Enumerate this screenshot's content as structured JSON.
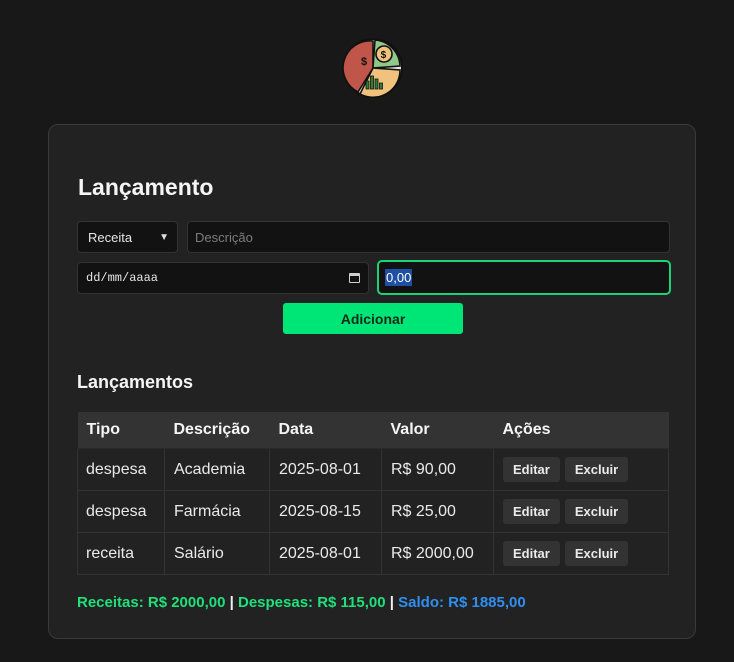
{
  "form": {
    "title": "Lançamento",
    "type_select": {
      "selected": "Receita",
      "chevron_icon": "chevron-down-icon"
    },
    "description_input": {
      "placeholder": "Descrição"
    },
    "date_input": {
      "placeholder": "dd/mm/aaaa",
      "icon": "calendar-icon"
    },
    "value_input": {
      "value": "0,00"
    },
    "add_button": "Adicionar"
  },
  "list": {
    "title": "Lançamentos",
    "columns": [
      "Tipo",
      "Descrição",
      "Data",
      "Valor",
      "Ações"
    ],
    "rows": [
      {
        "tipo": "despesa",
        "descricao": "Academia",
        "data": "2025-08-01",
        "valor": "R$ 90,00",
        "edit": "Editar",
        "delete": "Excluir"
      },
      {
        "tipo": "despesa",
        "descricao": "Farmácia",
        "data": "2025-08-15",
        "valor": "R$ 25,00",
        "edit": "Editar",
        "delete": "Excluir"
      },
      {
        "tipo": "receita",
        "descricao": "Salário",
        "data": "2025-08-01",
        "valor": "R$ 2000,00",
        "edit": "Editar",
        "delete": "Excluir"
      }
    ]
  },
  "totals": {
    "receitas": "Receitas: R$ 2000,00",
    "despesas": "Despesas: R$ 115,00",
    "saldo": "Saldo: R$ 1885,00",
    "separator": "|"
  },
  "colors": {
    "accent": "#00e676",
    "income": "#1fe07a",
    "balance": "#2f8ff0",
    "background": "#181818",
    "card": "#222222"
  },
  "logo": {
    "icon": "finance-pie-logo-icon"
  }
}
